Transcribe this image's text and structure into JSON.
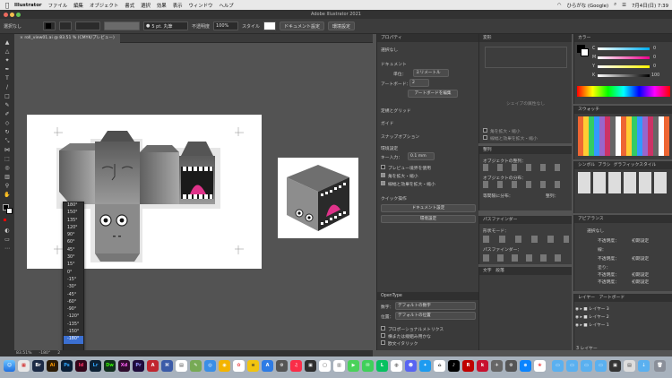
{
  "menubar": {
    "app": "Illustrator",
    "items": [
      "ファイル",
      "編集",
      "オブジェクト",
      "書式",
      "選択",
      "効果",
      "表示",
      "ウィンドウ",
      "ヘルプ"
    ],
    "input_method": "ひらがな (Google)",
    "datetime": "7月4日(日) 7:39"
  },
  "window": {
    "title": "Adobe Illustrator 2021"
  },
  "control": {
    "selection": "選択なし",
    "stroke_style": "5 pt. 丸筆",
    "opacity_label": "不透明度",
    "opacity_value": "100%",
    "style_label": "スタイル",
    "doc_setup": "ドキュメント設定",
    "env_setup": "環境設定"
  },
  "document_tab": "roll_view01.ai @ 83.51 % (CMYK/プレビュー)",
  "properties": {
    "tab": "プロパティ",
    "no_selection": "選択なし",
    "document_label": "ドキュメント",
    "unit_label": "単位：",
    "unit_value": "ミリメートル",
    "artboard_label": "アートボード：",
    "artboard_value": "2",
    "artboard_edit": "アートボードを編集",
    "rulers_grid": "定規とグリッド",
    "guides": "ガイド",
    "snap": "スナップオプション",
    "prefs": "環境設定",
    "key_input_label": "キー入力：",
    "key_input_value": "0.1 mm",
    "preview_bounds": "プレビュー境界を使用",
    "scale_corners": "角を拡大・縮小",
    "scale_strokes": "線幅と効果を拡大・縮小",
    "quick_actions": "クイック操作",
    "btn_doc_setup": "ドキュメント設定",
    "btn_prefs": "環境設定"
  },
  "transform_panel": {
    "tab": "変形",
    "shape_msg": "シェイプの属性なし",
    "scale_corners": "角を拡大・縮小",
    "scale_strokes": "線幅と効果を拡大・縮小"
  },
  "align_panel": {
    "tab": "整列",
    "align_objects": "オブジェクトの整列：",
    "distribute_objects": "オブジェクトの分布：",
    "distribute_spacing": "等間隔に分布：",
    "align_to": "整列："
  },
  "pathfinder": {
    "tab": "パスファインダー",
    "shape_modes": "形状モード：",
    "pathfinders": "パスファインダー："
  },
  "char_tabs": [
    "文字",
    "段落"
  ],
  "opentype": {
    "tab": "OpenType",
    "numbers_label": "数字：",
    "numbers_value": "デフォルトの数字",
    "position_label": "位置：",
    "position_value": "デフォルトの位置",
    "opt1": "プロポーショナルメトリクス",
    "opt2": "横または縦組み用かな",
    "opt3": "欧文イタリック"
  },
  "color_panel": {
    "tab": "カラー",
    "channels": [
      {
        "name": "C",
        "value": "0"
      },
      {
        "name": "M",
        "value": "0"
      },
      {
        "name": "Y",
        "value": "0"
      },
      {
        "name": "K",
        "value": "100"
      }
    ]
  },
  "swatches": {
    "tab": "スウォッチ"
  },
  "symbols": {
    "tabs": [
      "シンボル",
      "ブラシ",
      "グラフィックスタイル"
    ]
  },
  "appearance": {
    "tab": "アピアランス",
    "no_selection": "選択なし",
    "rows": [
      {
        "label": "不透明度：",
        "value": "初期設定"
      },
      {
        "label": "線：",
        "value": ""
      },
      {
        "label": "不透明度：",
        "value": "初期設定"
      },
      {
        "label": "塗り：",
        "value": ""
      },
      {
        "label": "不透明度：",
        "value": "初期設定"
      },
      {
        "label": "不透明度：",
        "value": "初期設定"
      }
    ]
  },
  "layers": {
    "tabs": [
      "レイヤー",
      "アートボード"
    ],
    "items": [
      "レイヤー 3",
      "レイヤー 2",
      "レイヤー 1"
    ],
    "count": "3 レイヤー"
  },
  "rotation_menu": {
    "options": [
      "180°",
      "150°",
      "135°",
      "120°",
      "90°",
      "60°",
      "45°",
      "30°",
      "15°",
      "0°",
      "-15°",
      "-30°",
      "-45°",
      "-60°",
      "-90°",
      "-120°",
      "-135°",
      "-150°",
      "-180°"
    ],
    "selected": "-180°"
  },
  "status": {
    "zoom": "83.51%",
    "angle": "-180°",
    "artboard": "2"
  },
  "dock": {
    "apps": [
      {
        "label": "Br",
        "color": "#1b2a45"
      },
      {
        "label": "Ai",
        "color": "#2b1b05"
      },
      {
        "label": "Ps",
        "color": "#0b1f36"
      },
      {
        "label": "Id",
        "color": "#33061a"
      },
      {
        "label": "Lr",
        "color": "#0d2134"
      },
      {
        "label": "Dw",
        "color": "#122f1f"
      },
      {
        "label": "Xd",
        "color": "#2e0b2c"
      },
      {
        "label": "Pr",
        "color": "#1f0b3b"
      },
      {
        "label": "A",
        "color": "#c0262f"
      }
    ]
  },
  "colors": {
    "accent": "#3b6fd1",
    "panel_bg": "#3d3d3d",
    "canvas_bg": "#535353",
    "pink": "#e0338a"
  }
}
